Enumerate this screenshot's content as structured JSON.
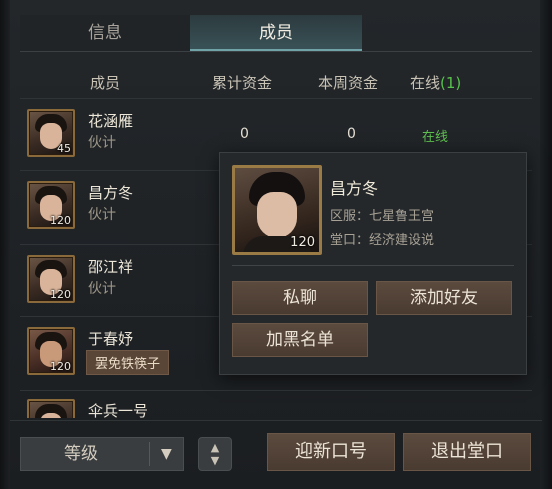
{
  "tabs": {
    "info": "信息",
    "members": "成员"
  },
  "headers": {
    "member": "成员",
    "total_funds": "累计资金",
    "weekly_funds": "本周资金",
    "online": "在线",
    "online_count": "(1)"
  },
  "members": [
    {
      "name": "花涵雁",
      "role": "伙计",
      "level": "45",
      "total": "0",
      "weekly": "0",
      "status": "在线"
    },
    {
      "name": "昌方冬",
      "role": "伙计",
      "level": "120"
    },
    {
      "name": "邵江祥",
      "role": "伙计",
      "level": "120"
    },
    {
      "name": "于春妤",
      "role": "罢免铁筷子",
      "level": "120"
    },
    {
      "name": "伞兵一号",
      "level": ""
    }
  ],
  "popup": {
    "name": "昌方冬",
    "level": "120",
    "server_line": "区服：七星鲁王宫",
    "hall_line": "堂口：经济建设说",
    "buttons": {
      "chat": "私聊",
      "add_friend": "添加好友",
      "blacklist": "加黑名单"
    }
  },
  "bottom": {
    "sort_select": "等级",
    "recruit_button": "迎新口号",
    "leave_button": "退出堂口"
  },
  "colors": {
    "online_green": "#5ec04f",
    "accent_teal": "#3a5358",
    "button_brown": "#5b4a3e"
  },
  "icons": {
    "sort": "sort-arrows-icon",
    "dropdown": "triangle-down-icon"
  }
}
